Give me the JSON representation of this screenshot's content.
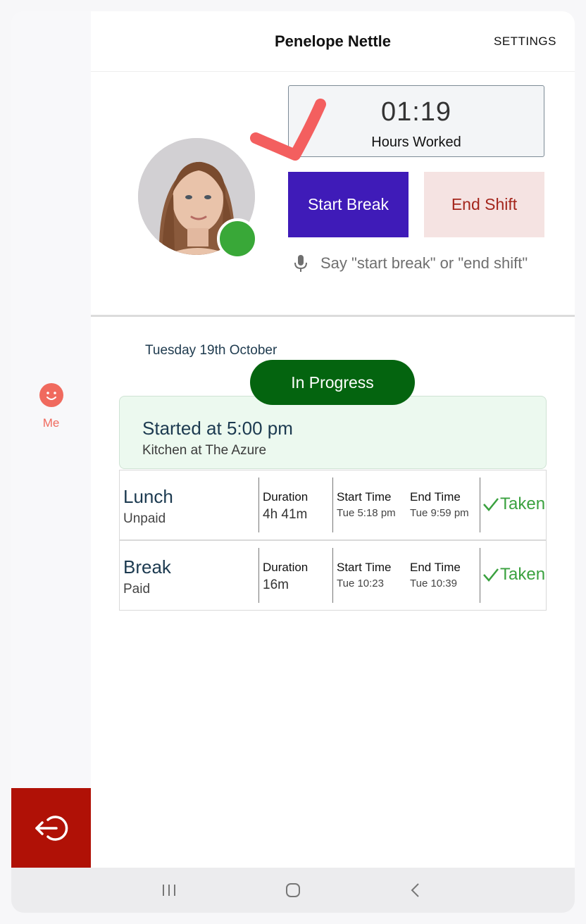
{
  "header": {
    "title": "Penelope Nettle",
    "settings_label": "SETTINGS"
  },
  "sidebar": {
    "me_label": "Me",
    "me_icon": "smiley-face-icon",
    "logout_icon": "logout-icon",
    "accent": "#f06a5e",
    "logout_bg": "#b01106"
  },
  "profile": {
    "avatar": "user-avatar-photo",
    "status": "online",
    "status_color": "#39a838"
  },
  "hours": {
    "value": "01:19",
    "label": "Hours Worked"
  },
  "actions": {
    "start_break_label": "Start Break",
    "end_shift_label": "End Shift",
    "voice_hint": "Say \"start break\" or \"end shift\""
  },
  "shift": {
    "date": "Tuesday 19th October",
    "status": "In Progress",
    "started": "Started at 5:00 pm",
    "location": "Kitchen at The Azure"
  },
  "breaks": [
    {
      "name": "Lunch",
      "type": "Unpaid",
      "duration_label": "Duration",
      "duration": "4h 41m",
      "start_label": "Start Time",
      "start": "Tue 5:18 pm",
      "end_label": "End Time",
      "end": "Tue 9:59 pm",
      "status": "Taken"
    },
    {
      "name": "Break",
      "type": "Paid",
      "duration_label": "Duration",
      "duration": "16m",
      "start_label": "Start Time",
      "start": "Tue 10:23",
      "end_label": "End Time",
      "end": "Tue 10:39",
      "status": "Taken"
    }
  ],
  "colors": {
    "primary": "#3f1bb8",
    "danger_text": "#a4261c",
    "danger_bg": "#f5e3e2",
    "in_progress": "#04640f",
    "taken": "#3aa13f"
  }
}
